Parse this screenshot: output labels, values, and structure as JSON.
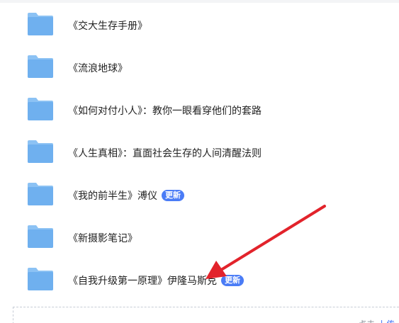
{
  "folders": [
    {
      "name": "《交大生存手册》",
      "badge": ""
    },
    {
      "name": "《流浪地球》",
      "badge": ""
    },
    {
      "name": "《如何对付小人》：教你一眼看穿他们的套路",
      "badge": ""
    },
    {
      "name": "《人生真相》：直面社会生存的人间清醒法则",
      "badge": ""
    },
    {
      "name": "《我的前半生》溥仪",
      "badge": "更新"
    },
    {
      "name": "《新摄影笔记》",
      "badge": ""
    },
    {
      "name": "《自我升级第一原理》伊隆马斯克",
      "badge": "更新"
    }
  ],
  "footer": {
    "hint": "点击",
    "link": "上传"
  },
  "colors": {
    "folder": "#6fb0ef",
    "folder_tab": "#8cc2f4",
    "badge": "#4a7cf6",
    "arrow": "#e2232b"
  },
  "icons": {
    "folder": "folder-icon"
  }
}
